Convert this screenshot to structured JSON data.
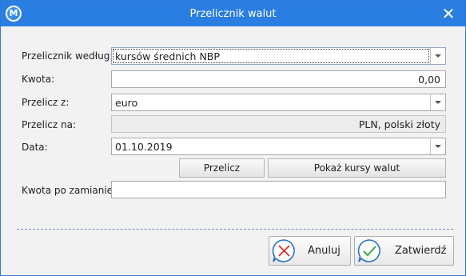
{
  "window": {
    "title": "Przelicznik walut",
    "app_icon": "M"
  },
  "form": {
    "basis": {
      "label": "Przelicznik według:",
      "value": "kursów średnich NBP"
    },
    "amount": {
      "label": "Kwota:",
      "value": "0,00"
    },
    "from": {
      "label": "Przelicz z:",
      "value": "euro"
    },
    "to": {
      "label": "Przelicz na:",
      "value": "PLN, polski złoty"
    },
    "date": {
      "label": "Data:",
      "value": "01.10.2019"
    },
    "result": {
      "label": "Kwota po zamianie:",
      "value": ""
    }
  },
  "buttons": {
    "convert": "Przelicz",
    "show_rates": "Pokaż kursy walut",
    "cancel": "Anuluj",
    "confirm": "Zatwierdź"
  },
  "colors": {
    "titlebar": "#2a7de1",
    "cancel_icon": "#d9302c",
    "confirm_icon": "#3aa64a",
    "icon_ring": "#2a6fc9"
  }
}
